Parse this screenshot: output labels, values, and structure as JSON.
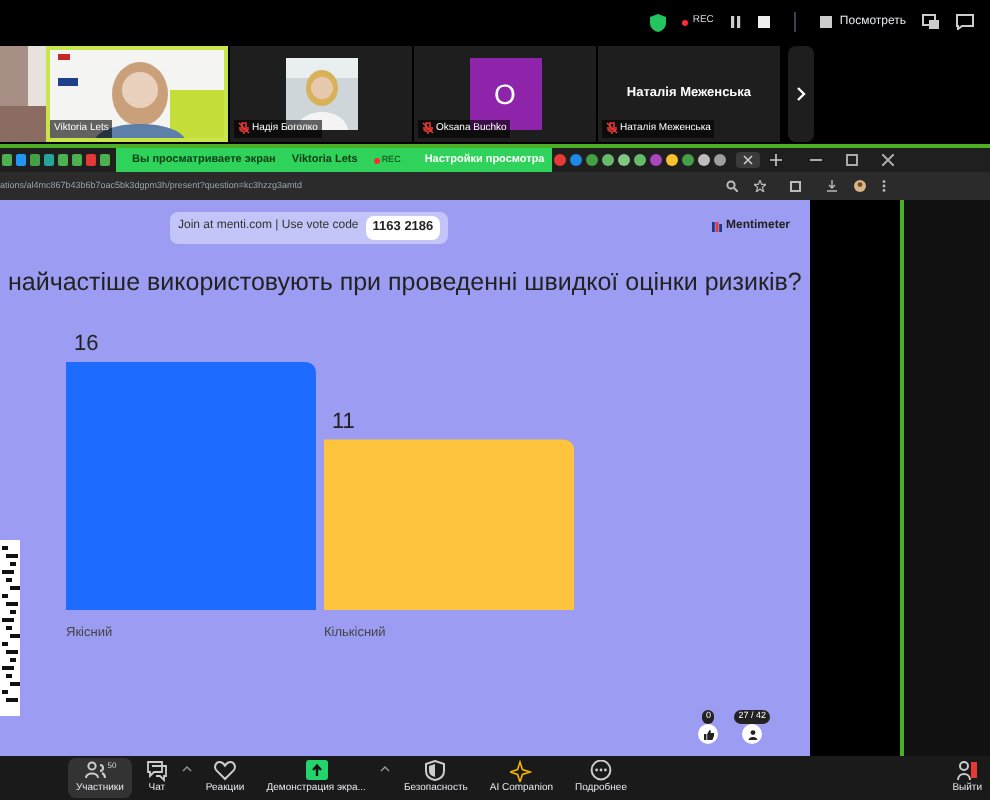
{
  "top_bar": {
    "rec": "REC",
    "view_button": "Посмотреть"
  },
  "participants": [
    {
      "kind": "video",
      "name": "Viktoria Lets",
      "selected": true,
      "muted": false
    },
    {
      "name": "Надія Боголко",
      "selected": false,
      "muted": true
    },
    {
      "kind": "avatar",
      "name": "Oksana Buchko",
      "initial": "O",
      "color": "#8e24aa",
      "selected": false,
      "muted": true
    },
    {
      "kind": "text",
      "name": "Наталія Меженська",
      "display_name": "Наталія Меженська",
      "selected": false,
      "muted": true
    }
  ],
  "share_banner": {
    "text": "Вы просматриваете экран",
    "presenter": "Viktoria Lets",
    "rec": "REC",
    "settings": "Настройки просмотра"
  },
  "browser": {
    "url": "ations/al4mc867b43b6b7oac5bk3dgpm3h/present?question=kc3hzzg3amtd"
  },
  "slide": {
    "join_text": "Join at menti.com | Use vote code",
    "vote_code": "1163 2186",
    "brand": "Mentimeter",
    "question": "найчастіше використовують при проведенні швидкої оцінки ризиків?",
    "chart_data": {
      "type": "bar",
      "categories": [
        "Якісний",
        "Кількісний"
      ],
      "series": [
        {
          "color": "#1e6bff",
          "values": [
            16,
            null
          ]
        },
        {
          "color": "#ffc43d",
          "values": [
            null,
            11
          ]
        }
      ],
      "data_labels": true
    },
    "reactions": "0",
    "responses": "27 / 42"
  },
  "toolbar": [
    {
      "kind": "people",
      "label": "Участники",
      "badge": "50",
      "caret": false,
      "selected": true
    },
    {
      "kind": "chat",
      "label": "Чат",
      "caret": true,
      "selected": false
    },
    {
      "kind": "heart",
      "label": "Реакции",
      "caret": false,
      "selected": false
    },
    {
      "kind": "share",
      "label": "Демонстрация экра...",
      "caret": true,
      "selected": false
    },
    {
      "kind": "shield",
      "label": "Безопасность",
      "caret": false,
      "selected": false
    },
    {
      "kind": "sparkle",
      "label": "AI Companion",
      "caret": false,
      "selected": false
    },
    {
      "kind": "more",
      "label": "Подробнее",
      "caret": false,
      "selected": false
    }
  ],
  "leave_button": "Выйти"
}
